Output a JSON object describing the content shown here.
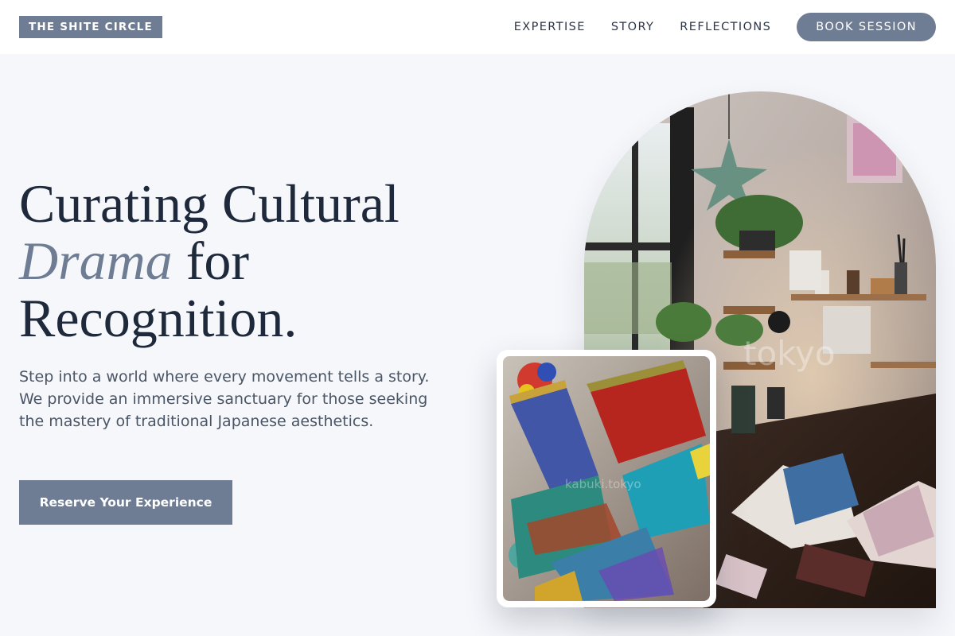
{
  "header": {
    "logo": "THE SHITE CIRCLE",
    "nav": [
      {
        "label": "EXPERTISE"
      },
      {
        "label": "STORY"
      },
      {
        "label": "REFLECTIONS"
      }
    ],
    "cta": "BOOK SESSION"
  },
  "hero": {
    "title_line1": "Curating Cultural",
    "title_em": "Drama",
    "title_line2_rest": " for",
    "title_line3": "Recognition.",
    "subtitle": "Step into a world where every movement tells a story. We provide an immersive sanctuary for those seeking the mastery of traditional Japanese aesthetics.",
    "button": "Reserve Your Experience"
  },
  "images": {
    "studio_watermark": "tokyo",
    "brushes_watermark": "kabuki.tokyo"
  },
  "colors": {
    "accent": "#6e7d93",
    "text_dark": "#1e293b",
    "background": "#f6f7fb"
  }
}
